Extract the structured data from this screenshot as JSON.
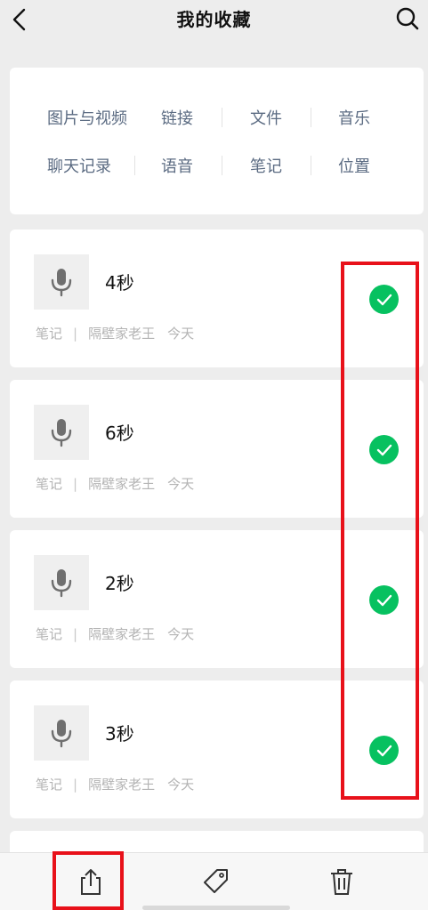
{
  "header": {
    "title": "我的收藏"
  },
  "categories": {
    "row1": [
      "图片与视频",
      "链接",
      "文件",
      "音乐"
    ],
    "row2": [
      "聊天记录",
      "语音",
      "笔记",
      "位置"
    ]
  },
  "notes": [
    {
      "duration": "4秒",
      "type": "笔记",
      "separator": "|",
      "author": "隔壁家老王",
      "time": "今天",
      "selected": true
    },
    {
      "duration": "6秒",
      "type": "笔记",
      "separator": "|",
      "author": "隔壁家老王",
      "time": "今天",
      "selected": true
    },
    {
      "duration": "2秒",
      "type": "笔记",
      "separator": "|",
      "author": "隔壁家老王",
      "time": "今天",
      "selected": true
    },
    {
      "duration": "3秒",
      "type": "笔记",
      "separator": "|",
      "author": "隔壁家老王",
      "time": "今天",
      "selected": true
    }
  ],
  "icons": {
    "back": "chevron-left-icon",
    "search": "search-icon",
    "voice": "microphone-icon",
    "check": "check-circle-icon",
    "share": "share-icon",
    "tag": "tag-icon",
    "delete": "trash-icon"
  },
  "colors": {
    "accent": "#07c160",
    "highlight": "#e8111a",
    "category_text": "#5b6b82",
    "meta_text": "#b4b4b4"
  }
}
